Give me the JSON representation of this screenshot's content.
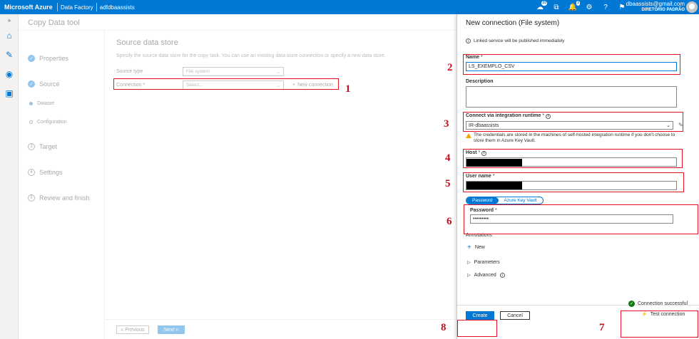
{
  "topbar": {
    "brand": "Microsoft Azure",
    "breadcrumb": [
      "Data Factory",
      "adfdbaassists"
    ],
    "icons": [
      {
        "name": "cloud-shell-icon",
        "badge": "20"
      },
      {
        "name": "directory-filter-icon",
        "badge": ""
      },
      {
        "name": "notifications-icon",
        "badge": "2"
      },
      {
        "name": "settings-icon",
        "badge": ""
      },
      {
        "name": "help-icon",
        "badge": ""
      },
      {
        "name": "feedback-icon",
        "badge": ""
      }
    ],
    "user_email": "dbaassists@gmail.com",
    "user_directory": "DIRETÓRIO PADRÃO"
  },
  "rail": {
    "collapse_label": "»",
    "items": [
      "home-icon",
      "author-icon",
      "monitor-icon",
      "manage-icon"
    ]
  },
  "tool": {
    "title": "Copy Data tool",
    "steps": [
      {
        "label": "Properties",
        "done": true
      },
      {
        "label": "Source",
        "done": true
      },
      {
        "label": "Dataset",
        "done": true,
        "sub": true
      },
      {
        "label": "Configuration",
        "done": false,
        "sub": true
      },
      {
        "label": "Target",
        "done": false
      },
      {
        "label": "Settings",
        "done": false
      },
      {
        "label": "Review and finish",
        "done": false
      }
    ],
    "source": {
      "title": "Source data store",
      "description": "Specify the source data store for the copy task. You can use an existing data store connection or specify a new data store.",
      "source_type_label": "Source type",
      "source_type_value": "File system",
      "connection_label": "Connection *",
      "connection_placeholder": "Select...",
      "new_connection_label": "New connection"
    },
    "nav": {
      "previous": "« Previous",
      "next": "Next »"
    }
  },
  "panel": {
    "title": "New connection (File system)",
    "info": "Linked service will be published immediately",
    "name_label": "Name",
    "name_value": "LS_EXEMPLO_CSV",
    "description_label": "Description",
    "runtime_label": "Connect via integration runtime",
    "runtime_value": "IR-dbaassists",
    "warning": "The credentials are stored in the machines of self-hosted integration runtime if you don't choose to store them in Azure Key Vault.",
    "host_label": "Host",
    "username_label": "User name",
    "tabs": [
      "Password",
      "Azure Key Vault"
    ],
    "password_label": "Password",
    "password_value": "•••••••••",
    "annotations_label": "Annotations",
    "new_label": "New",
    "parameters_label": "Parameters",
    "advanced_label": "Advanced",
    "create_label": "Create",
    "cancel_label": "Cancel",
    "connection_status": "Connection successful",
    "test_connection_label": "Test connection"
  },
  "annotations": [
    "1",
    "2",
    "3",
    "4",
    "5",
    "6",
    "7",
    "8"
  ]
}
